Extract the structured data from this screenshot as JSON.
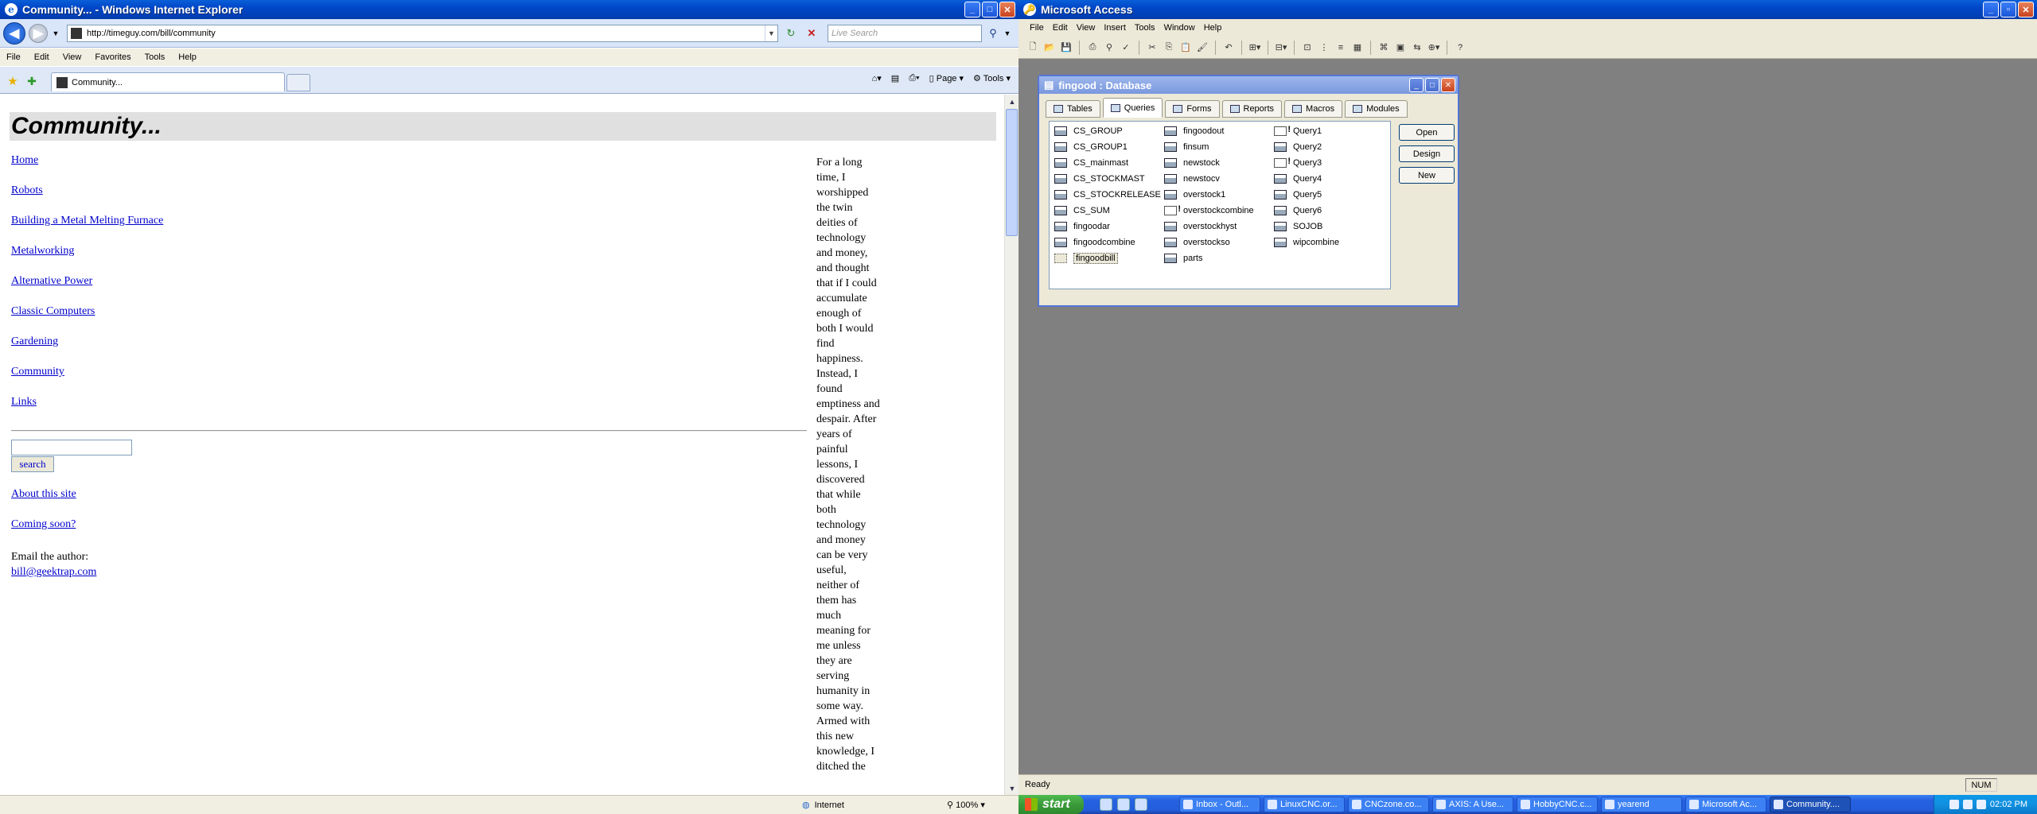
{
  "ie": {
    "window_title": "Community... - Windows Internet Explorer",
    "address": "http://timeguy.com/bill/community",
    "search_placeholder": "Live Search",
    "menu": [
      "File",
      "Edit",
      "View",
      "Favorites",
      "Tools",
      "Help"
    ],
    "tab_label": "Community...",
    "cmd_page": "Page",
    "cmd_tools": "Tools",
    "page": {
      "title": "Community...",
      "nav": [
        "Home",
        "Robots",
        "Building a Metal Melting Furnace",
        "Metalworking",
        "Alternative Power",
        "Classic Computers",
        "Gardening",
        "Community",
        "Links"
      ],
      "search_button": "search",
      "about_links": [
        "About this site",
        "Coming soon?"
      ],
      "email_label": "Email the author:",
      "email": "bill@geektrap.com",
      "essay": "For a long time, I worshipped the twin deities of technology and money, and thought that if I could accumulate enough of both I would find happiness. Instead, I found emptiness and despair. After years of painful lessons, I discovered that while both technology and money can be very useful, neither of them has much meaning for me unless they are serving humanity in some way. Armed with this new knowledge, I ditched the"
    },
    "status": {
      "zone": "Internet",
      "zoom": "100%"
    }
  },
  "access": {
    "window_title": "Microsoft Access",
    "menu": [
      "File",
      "Edit",
      "View",
      "Insert",
      "Tools",
      "Window",
      "Help"
    ],
    "db": {
      "title": "fingood : Database",
      "tabs": [
        "Tables",
        "Queries",
        "Forms",
        "Reports",
        "Macros",
        "Modules"
      ],
      "active_tab": "Queries",
      "col1": [
        "CS_GROUP",
        "CS_GROUP1",
        "CS_mainmast",
        "CS_STOCKMAST",
        "CS_STOCKRELEASE",
        "CS_SUM",
        "fingoodar",
        "fingoodcombine",
        "fingoodbill"
      ],
      "col2": [
        "fingoodout",
        "finsum",
        "newstock",
        "newstocv",
        "overstock1",
        "overstockcombine",
        "overstockhyst",
        "overstockso",
        "parts"
      ],
      "col3": [
        "Query1",
        "Query2",
        "Query3",
        "Query4",
        "Query5",
        "Query6",
        "SOJOB",
        "wipcombine"
      ],
      "buttons": [
        "Open",
        "Design",
        "New"
      ]
    },
    "status": {
      "ready": "Ready",
      "num": "NUM"
    }
  },
  "taskbar": {
    "start": "start",
    "tasks": [
      "Inbox - Outl...",
      "LinuxCNC.or...",
      "CNCzone.co...",
      "AXIS: A Use...",
      "HobbyCNC.c...",
      "yearend",
      "Microsoft Ac...",
      "Community...."
    ],
    "clock": "02:02 PM"
  }
}
